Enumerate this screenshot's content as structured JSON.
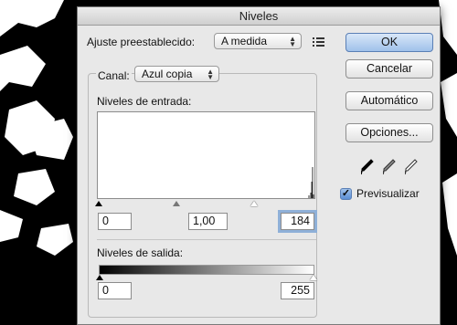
{
  "window": {
    "title": "Niveles"
  },
  "preset": {
    "label": "Ajuste preestablecido:",
    "value": "A medida",
    "menu_icon": "options-list-icon"
  },
  "channel": {
    "label": "Canal:",
    "value": "Azul copia"
  },
  "input_levels": {
    "label": "Niveles de entrada:",
    "black": "0",
    "gamma": "1,00",
    "white": "184"
  },
  "output_levels": {
    "label": "Niveles de salida:",
    "black": "0",
    "white": "255"
  },
  "buttons": {
    "ok": "OK",
    "cancel": "Cancelar",
    "auto": "Automático",
    "options": "Opciones..."
  },
  "eyedroppers": [
    "black-eyedropper-icon",
    "gray-eyedropper-icon",
    "white-eyedropper-icon"
  ],
  "preview": {
    "label": "Previsualizar",
    "checked": true
  },
  "colors": {
    "accent": "#5b8fd6",
    "dialog_bg": "#e8e8e8"
  }
}
